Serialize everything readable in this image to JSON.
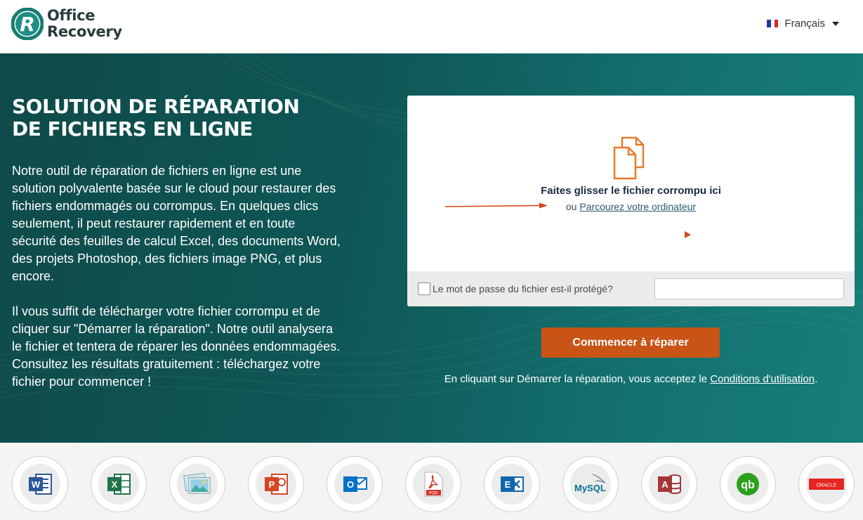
{
  "header": {
    "logo_line1": "Office",
    "logo_line2": "Recovery",
    "language": "Français"
  },
  "hero": {
    "title_line1": "SOLUTION DE RÉPARATION",
    "title_line2": "DE FICHIERS EN LIGNE",
    "paragraph1": "Notre outil de réparation de fichiers en ligne est une solution polyvalente basée sur le cloud pour restaurer des fichiers endommagés ou corrompus. En quelques clics seulement, il peut restaurer rapidement et en toute sécurité des feuilles de calcul Excel, des documents Word, des projets Photoshop, des fichiers image PNG, et plus encore.",
    "paragraph2": "Il vous suffit de télécharger votre fichier corrompu et de cliquer sur \"Démarrer la réparation\". Notre outil analysera le fichier et tentera de réparer les données endommagées. Consultez les résultats gratuitement : téléchargez votre fichier pour commencer !"
  },
  "upload": {
    "drop_title": "Faites glisser le fichier corrompu ici",
    "or_text": "ou",
    "browse_link": "Parcourez votre ordinateur",
    "password_label": "Le mot de passe du fichier est-il protégé?",
    "password_value": "",
    "start_button": "Commencer à réparer",
    "terms_prefix": "En cliquant sur Démarrer la réparation, vous acceptez le",
    "terms_link": "Conditions d'utilisation",
    "terms_suffix": "."
  },
  "formats": [
    {
      "icon": "word-icon",
      "label": "W",
      "color": "#2b579a"
    },
    {
      "icon": "excel-icon",
      "label": "X",
      "color": "#217346"
    },
    {
      "icon": "image-icon",
      "label": "",
      "color": "#3fa9d6"
    },
    {
      "icon": "powerpoint-icon",
      "label": "P",
      "color": "#d24726"
    },
    {
      "icon": "outlook-icon",
      "label": "O",
      "color": "#0072c6"
    },
    {
      "icon": "pdf-icon",
      "label": "PDF",
      "color": "#d2332a"
    },
    {
      "icon": "exchange-icon",
      "label": "E",
      "color": "#0f67b0"
    },
    {
      "icon": "mysql-icon",
      "label": "MySQL",
      "color": "#00758f"
    },
    {
      "icon": "access-icon",
      "label": "A",
      "color": "#a4373a"
    },
    {
      "icon": "quickbooks-icon",
      "label": "qb",
      "color": "#2ca01c"
    },
    {
      "icon": "oracle-icon",
      "label": "ORACLE",
      "color": "#e52620"
    }
  ],
  "colors": {
    "accent": "#c85416",
    "hero_dark": "#0f4a4a",
    "hero_light": "#187d78"
  }
}
